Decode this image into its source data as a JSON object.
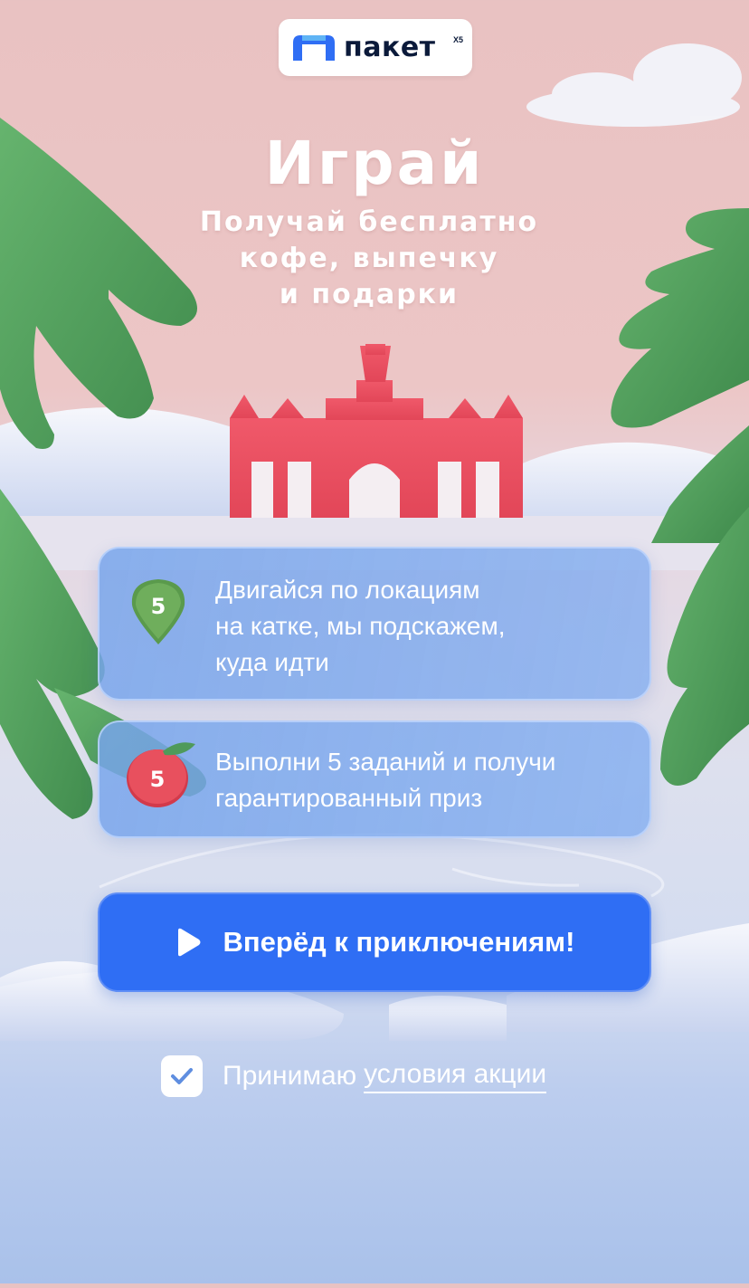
{
  "logo": {
    "brand": "пакет",
    "sub": "X5",
    "icon": "paket-logo-icon"
  },
  "hero": {
    "title": "Играй",
    "subtitle_lines": [
      "Получай бесплатно",
      "кофе, выпечку",
      "и подарки"
    ]
  },
  "cards": [
    {
      "badge_icon": "map-pin-icon",
      "badge_number": "5",
      "badge_color": "#5a9a4c",
      "lines": [
        "Двигайся по локациям",
        "на катке, мы подскажем,",
        "куда идти"
      ]
    },
    {
      "badge_icon": "apple-icon",
      "badge_number": "5",
      "badge_color": "#e34a5a",
      "lines": [
        "Выполни 5 заданий и получи",
        "гарантированный приз"
      ]
    }
  ],
  "cta": {
    "label": "Вперёд к приключениям!",
    "icon": "play-icon"
  },
  "terms": {
    "checked": true,
    "label": "Принимаю",
    "link": "условия акции"
  },
  "colors": {
    "accent": "#2f6ef4",
    "arch": "#e8505e",
    "tree": "#4f9a5a"
  }
}
